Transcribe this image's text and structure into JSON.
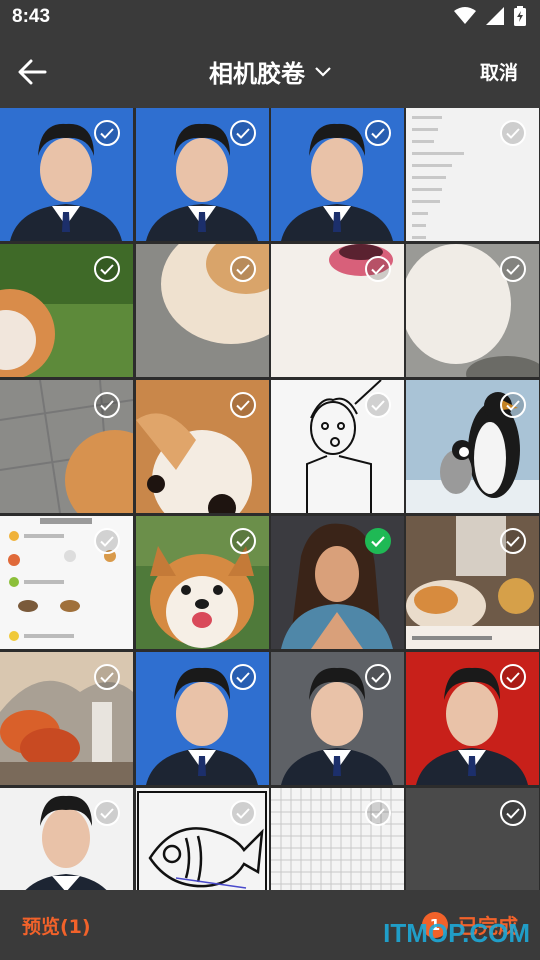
{
  "status": {
    "time": "8:43"
  },
  "header": {
    "title": "相机胶卷",
    "cancel_label": "取消"
  },
  "photos": [
    {
      "desc": "portrait-blue",
      "selected": false
    },
    {
      "desc": "portrait-blue",
      "selected": false
    },
    {
      "desc": "portrait-blue",
      "selected": false
    },
    {
      "desc": "text-note",
      "selected": false
    },
    {
      "desc": "dog-grass",
      "selected": false
    },
    {
      "desc": "dog-tail",
      "selected": false
    },
    {
      "desc": "dog-fur",
      "selected": false
    },
    {
      "desc": "pavement-dog",
      "selected": false
    },
    {
      "desc": "pavement-dog",
      "selected": false
    },
    {
      "desc": "corgi-close",
      "selected": false
    },
    {
      "desc": "drawing-face",
      "selected": false
    },
    {
      "desc": "penguins",
      "selected": false
    },
    {
      "desc": "meal-plan",
      "selected": false
    },
    {
      "desc": "corgi-smile",
      "selected": false
    },
    {
      "desc": "woman-portrait",
      "selected": true
    },
    {
      "desc": "cozy-wallpaper",
      "selected": false
    },
    {
      "desc": "autumn-painting",
      "selected": false
    },
    {
      "desc": "portrait-blue",
      "selected": false
    },
    {
      "desc": "portrait-gray",
      "selected": false
    },
    {
      "desc": "portrait-red",
      "selected": false
    },
    {
      "desc": "portrait-white",
      "selected": false
    },
    {
      "desc": "fish-drawing",
      "selected": false
    },
    {
      "desc": "grid-paper",
      "selected": false
    },
    {
      "desc": "blank-gray",
      "selected": false
    }
  ],
  "colors": {
    "accent": "#f2622a",
    "selected": "#1fb955",
    "bar": "#3a3a3a"
  },
  "footer": {
    "preview_label": "预览(1)",
    "count": "1",
    "done_label": "已完成"
  },
  "watermark": "ITMOP.COM"
}
